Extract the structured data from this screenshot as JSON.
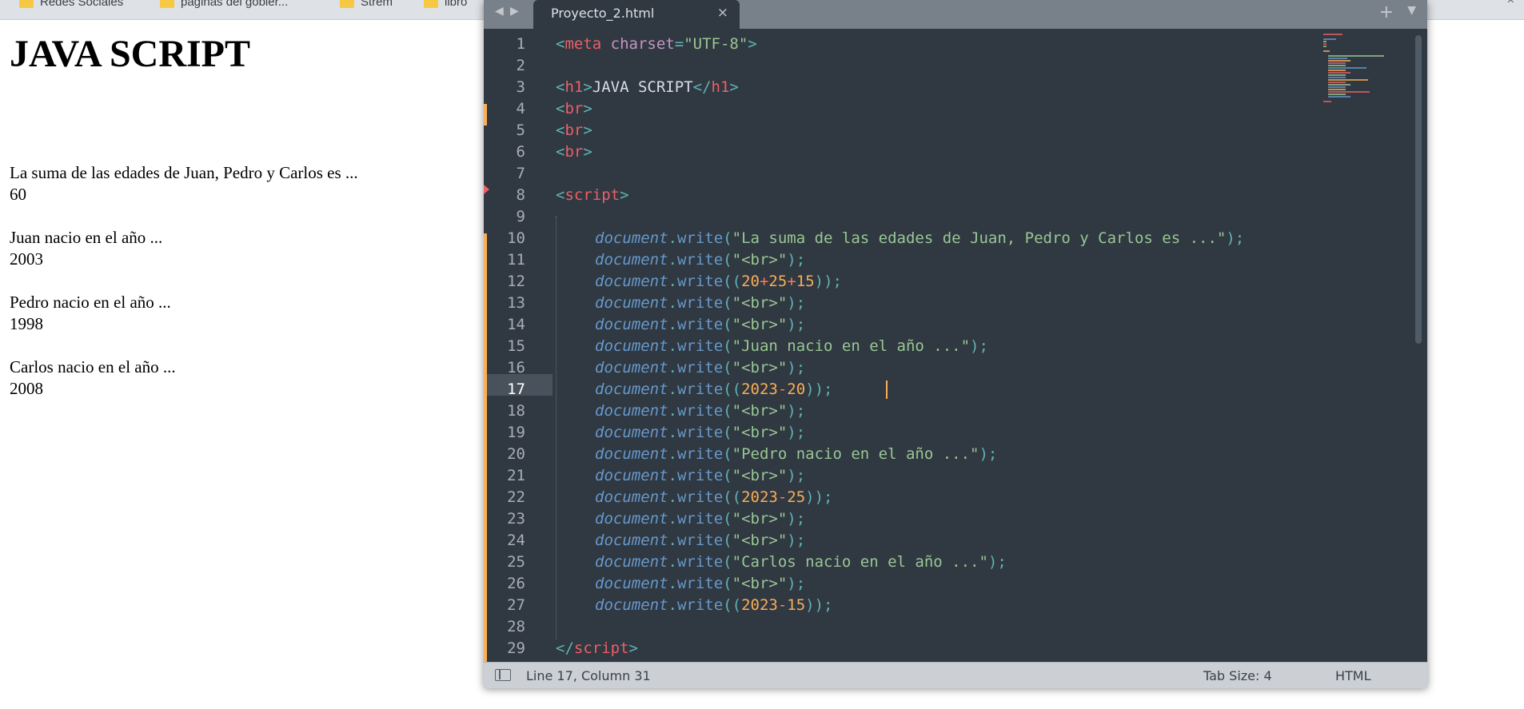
{
  "browser": {
    "bookmarks": [
      "Redes Sociales",
      "paginas del gobier...",
      "Strem",
      "libro"
    ],
    "close_glyph": "×"
  },
  "rendered_page": {
    "heading": "JAVA SCRIPT",
    "output_lines": [
      "La suma de las edades de Juan, Pedro y Carlos es ...",
      "60",
      "Juan nacio en el año ...",
      "2003",
      "Pedro nacio en el año ...",
      "1998",
      "Carlos nacio en el año ...",
      "2008"
    ]
  },
  "editor": {
    "tab_title": "Proyecto_2.html",
    "active_line": 17,
    "line_numbers": [
      "1",
      "2",
      "3",
      "4",
      "5",
      "6",
      "7",
      "8",
      "9",
      "10",
      "11",
      "12",
      "13",
      "14",
      "15",
      "16",
      "17",
      "18",
      "19",
      "20",
      "21",
      "22",
      "23",
      "24",
      "25",
      "26",
      "27",
      "28",
      "29"
    ],
    "code": {
      "l1_tag": "meta",
      "l1_attr": "charset",
      "l1_val": "\"UTF-8\"",
      "h1_tag": "h1",
      "h1_text": "JAVA SCRIPT",
      "br_tag": "br",
      "script_tag": "script",
      "obj": "document",
      "fn": "write",
      "str_sum": "\"La suma de las edades de Juan, Pedro y Carlos es ...\"",
      "str_br": "\"<br>\"",
      "str_juan": "\"Juan nacio en el año ...\"",
      "str_pedro": "\"Pedro nacio en el año ...\"",
      "str_carlos": "\"Carlos nacio en el año ...\"",
      "n20": "20",
      "n25": "25",
      "n15": "15",
      "n2023": "2023"
    },
    "status": {
      "position": "Line 17, Column 31",
      "tab_size": "Tab Size: 4",
      "syntax": "HTML"
    }
  },
  "colors": {
    "editor_bg": "#303841",
    "tag": "#ec5f67",
    "string": "#99c794",
    "number": "#f9ae58",
    "function": "#6699cc",
    "punctuation": "#5fb3b3"
  }
}
